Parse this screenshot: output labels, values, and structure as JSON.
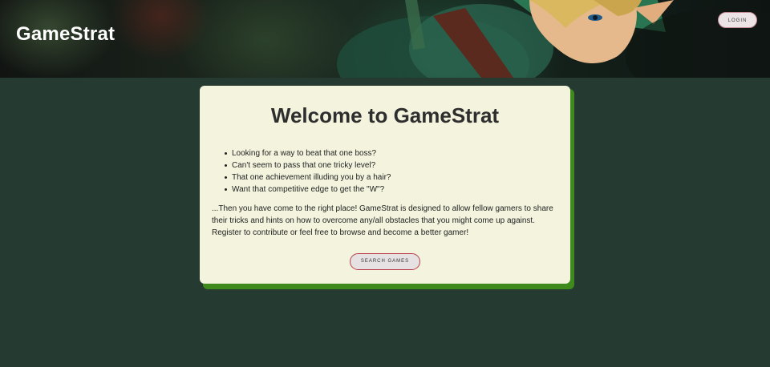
{
  "header": {
    "brand": "GameStrat",
    "login_label": "LOGIN"
  },
  "welcome": {
    "title": "Welcome to GameStrat",
    "points": [
      "Looking for a way to beat that one boss?",
      "Can't seem to pass that one tricky level?",
      "That one achievement illuding you by a hair?",
      "Want that competitive edge to get the \"W\"?"
    ],
    "description_lines": [
      "...Then you have come to the right place! GameStrat is designed to allow fellow gamers to share",
      "their tricks and hints on how to overcome any/all obstacles that you might come up against.",
      "Register to contribute or feel free to browse and become a better gamer!"
    ],
    "search_label": "SEARCH GAMES"
  },
  "colors": {
    "page_background": "#253b32",
    "card_background": "#f3f3de",
    "card_shadow": "#3f8a1c",
    "button_border": "#b8404c"
  },
  "icons": {
    "bullet": "bullet-dot-icon"
  }
}
